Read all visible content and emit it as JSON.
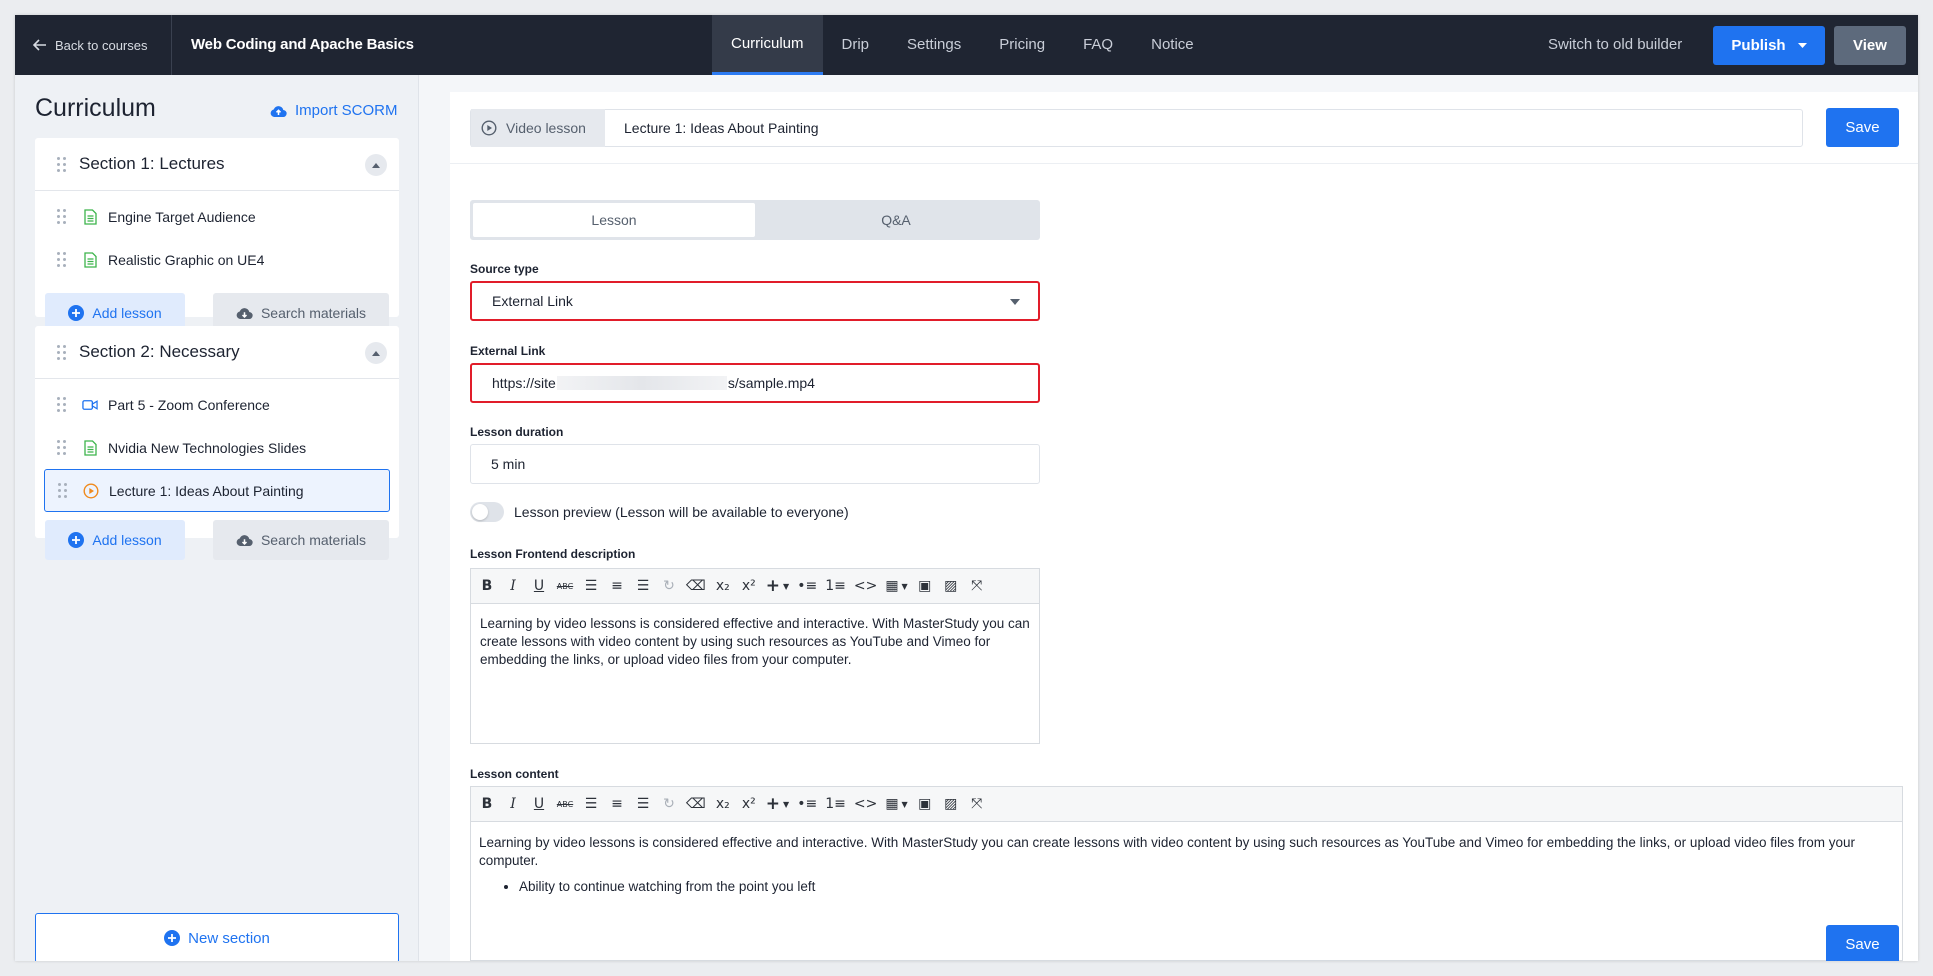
{
  "topbar": {
    "back_label": "Back to courses",
    "course_title": "Web Coding and Apache Basics",
    "tabs": [
      {
        "label": "Curriculum",
        "active": true
      },
      {
        "label": "Drip"
      },
      {
        "label": "Settings"
      },
      {
        "label": "Pricing"
      },
      {
        "label": "FAQ"
      },
      {
        "label": "Notice"
      }
    ],
    "switch_old_builder": "Switch to old builder",
    "publish_label": "Publish",
    "view_label": "View"
  },
  "sidebar": {
    "title": "Curriculum",
    "import_label": "Import SCORM",
    "sections": [
      {
        "title": "Section 1: Lectures",
        "lessons": [
          {
            "label": "Engine Target Audience",
            "icon": "document-icon"
          },
          {
            "label": "Realistic Graphic on UE4",
            "icon": "document-icon"
          }
        ]
      },
      {
        "title": "Section 2: Necessary",
        "lessons": [
          {
            "label": "Part 5 - Zoom Conference",
            "icon": "video-camera-icon"
          },
          {
            "label": "Nvidia New Technologies Slides",
            "icon": "document-icon"
          },
          {
            "label": "Lecture 1: Ideas About Painting",
            "icon": "play-circle-icon",
            "active": true
          }
        ]
      }
    ],
    "add_lesson_label": "Add lesson",
    "search_materials_label": "Search materials",
    "new_section_label": "New section"
  },
  "editor": {
    "lesson_type": "Video lesson",
    "lesson_title": "Lecture 1: Ideas About Painting",
    "save_label": "Save",
    "tabs": [
      "Lesson",
      "Q&A"
    ],
    "source_type_label": "Source type",
    "source_type_value": "External Link",
    "external_link_label": "External Link",
    "external_link_prefix": "https://site",
    "external_link_suffix": "s/sample.mp4",
    "duration_label": "Lesson duration",
    "duration_value": "5 min",
    "preview_label": "Lesson preview (Lesson will be available to everyone)",
    "frontend_desc_label": "Lesson Frontend description",
    "frontend_desc_text": "Learning by video lessons is considered effective and interactive. With MasterStudy you can create lessons with video content by using such resources as YouTube and Vimeo for embedding the links, or upload video files from your computer.",
    "content_label": "Lesson content",
    "content_text": "Learning by video lessons is considered effective and interactive. With MasterStudy you can create lessons with video content by using such resources as YouTube and Vimeo for embedding the links, or upload video files from your computer.",
    "content_bullet": "Ability to continue watching from the point you left"
  },
  "colors": {
    "accent": "#1f73f0",
    "topbar_bg": "#1f2532",
    "highlight_border": "#e11d2a"
  }
}
